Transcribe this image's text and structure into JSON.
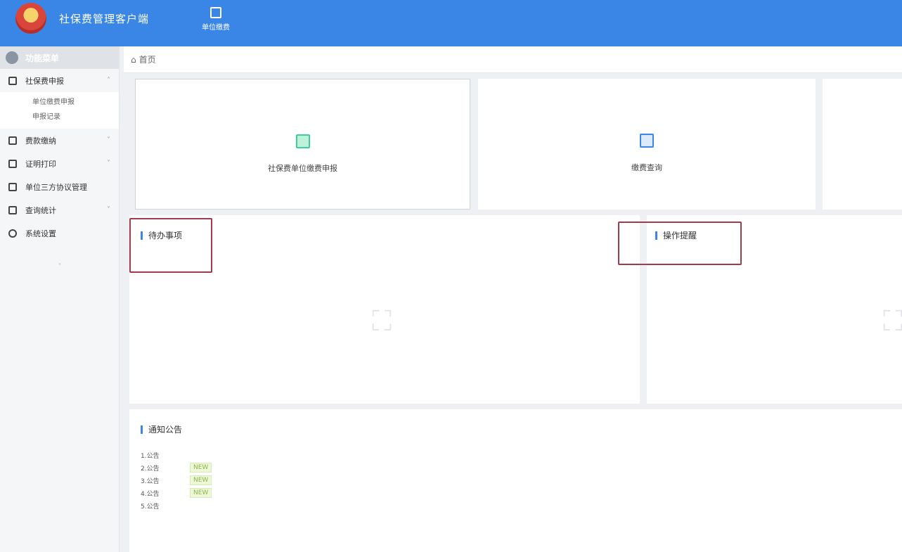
{
  "header": {
    "title": "社保费管理客户端",
    "top_nav": [
      {
        "label": "单位缴费",
        "icon": "document-icon"
      }
    ]
  },
  "sidebar": {
    "head_label": "功能菜单",
    "items": [
      {
        "label": "社保费申报",
        "icon": "calendar-icon",
        "expanded": true,
        "children": [
          "单位缴费申报",
          "申报记录"
        ]
      },
      {
        "label": "费款缴纳",
        "icon": "calendar-icon"
      },
      {
        "label": "证明打印",
        "icon": "printer-icon"
      },
      {
        "label": "单位三方协议管理",
        "icon": "calendar-icon"
      },
      {
        "label": "查询统计",
        "icon": "chart-icon"
      },
      {
        "label": "系统设置",
        "icon": "gear-icon"
      }
    ]
  },
  "breadcrumb": {
    "label": "首页"
  },
  "quick_cards": [
    {
      "label": "社保费单位缴费申报",
      "icon": "grid-icon",
      "color": "#3ccf9a"
    },
    {
      "label": "缴费查询",
      "icon": "report-icon",
      "color": "#3a86e6"
    }
  ],
  "panels": {
    "todo": {
      "title": "待办事项"
    },
    "tips": {
      "title": "操作提醒"
    },
    "notice": {
      "title": "通知公告",
      "items": [
        {
          "label": "1.公告",
          "tag": ""
        },
        {
          "label": "2.公告",
          "tag": "NEW"
        },
        {
          "label": "3.公告",
          "tag": "NEW"
        },
        {
          "label": "4.公告",
          "tag": "NEW"
        },
        {
          "label": "5.公告",
          "tag": ""
        }
      ]
    }
  },
  "colors": {
    "primary": "#3a86e6",
    "highlight_box": "#a13a4a",
    "tag_green": "#8ab54b"
  }
}
